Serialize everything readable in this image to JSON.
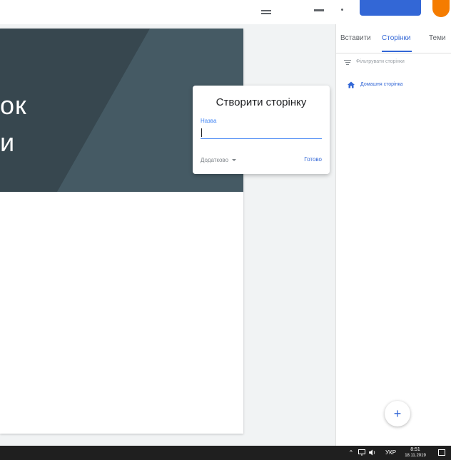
{
  "colors": {
    "accent": "#3367d6",
    "banner_dark": "#37474f",
    "banner_mid": "#455a64",
    "avatar": "#f57c00"
  },
  "icons": {
    "filter": "filter-icon",
    "home": "home-icon",
    "add": "plus-icon"
  },
  "header": {
    "title_lines": [
      "ок",
      "и"
    ]
  },
  "dialog": {
    "title": "Створити сторінку",
    "name_label": "Назва",
    "name_value": "",
    "more_label": "Додатково",
    "done_label": "Готово"
  },
  "panel": {
    "tabs": [
      {
        "label": "Вставити"
      },
      {
        "label": "Сторінки"
      },
      {
        "label": "Теми"
      }
    ],
    "filter_placeholder": "Фільтрувати сторінки",
    "pages": [
      {
        "label": "Домашня сторінка"
      }
    ],
    "fab_symbol": "+"
  },
  "taskbar": {
    "language": "УКР",
    "time": "8:51",
    "date": "18.11.2019"
  }
}
